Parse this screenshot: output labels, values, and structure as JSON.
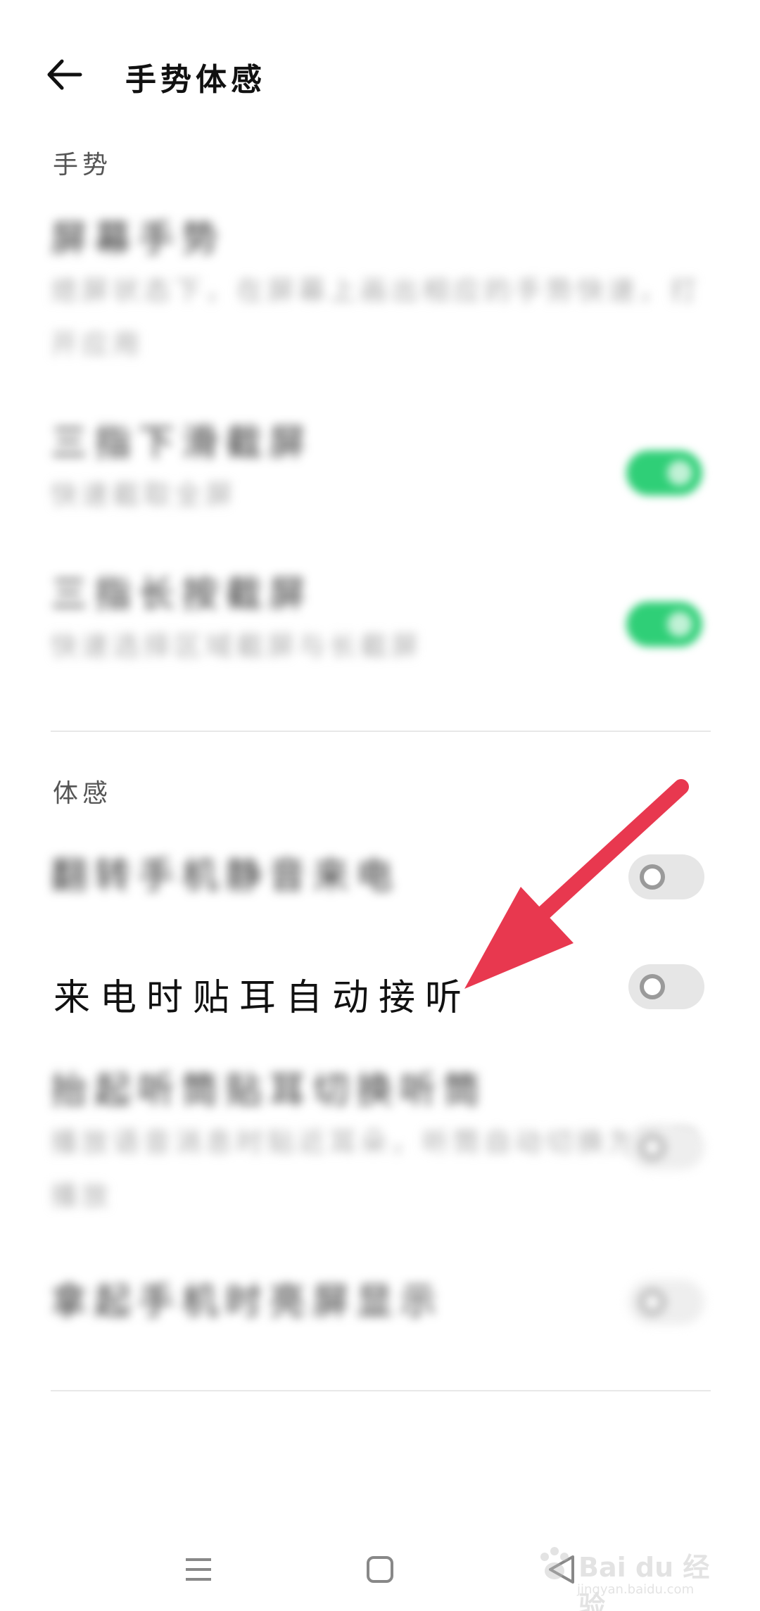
{
  "header": {
    "title": "手势体感"
  },
  "sections": {
    "gestures": "手势",
    "motion": "体感"
  },
  "blurred_items": [
    {
      "title": "屏幕手势",
      "subtitle": "熄屏状态下，在屏幕上画出相应的手势快速，打开应用"
    },
    {
      "title": "三指下滑截屏",
      "subtitle": "快速截取全屏"
    },
    {
      "title": "三指长按截屏",
      "subtitle": "快速选择区域截屏与长截屏"
    },
    {
      "title": "翻转手机静音来电",
      "subtitle": ""
    },
    {
      "title": "抬起听筒贴耳切换听筒",
      "subtitle": "播放语音消息时贴近耳朵，听筒自动切换为听筒播放"
    },
    {
      "title": "拿起手机时亮屏显示",
      "subtitle": ""
    }
  ],
  "clear_item": {
    "label": "来电时贴耳自动接听"
  },
  "toggles": {
    "three_finger_down": "on",
    "three_finger_hold": "on",
    "flip_mute": "off",
    "auto_answer": "off",
    "earpiece": "off",
    "raise_wake": "off"
  },
  "annotation": {
    "arrow_color": "#e8384f"
  },
  "watermark": {
    "text": "Bai du 经验",
    "url_text": "jingyan.baidu.com"
  },
  "nav_icons": [
    "menu-icon",
    "home-icon",
    "back-triangle-icon"
  ]
}
